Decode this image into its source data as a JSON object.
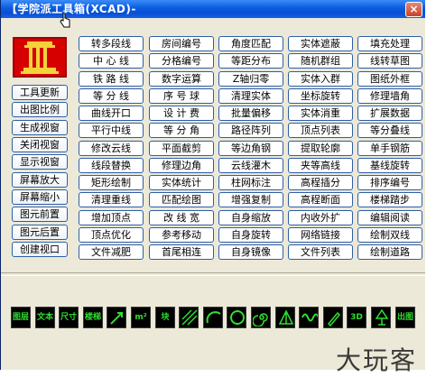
{
  "window": {
    "title": "【学院派工具箱(XCAD)-",
    "close": "×"
  },
  "left_buttons": [
    "工具更新",
    "出图比例",
    "生成视窗",
    "关闭视窗",
    "显示视窗",
    "屏幕放大",
    "屏幕缩小",
    "图元前置",
    "图元后置",
    "创建视口"
  ],
  "grid": [
    [
      "转多段线",
      "房间编号",
      "角度匹配",
      "实体遮蔽",
      "填充处理"
    ],
    [
      "中 心 线",
      "分格编号",
      "等距分布",
      "随机群组",
      "线转草图"
    ],
    [
      "铁 路 线",
      "数字运算",
      "Z轴归零",
      "实体入群",
      "图纸外框"
    ],
    [
      "等 分 线",
      "序 号 球",
      "清理实体",
      "坐标旋转",
      "修理墙角"
    ],
    [
      "曲线开口",
      "设 计 费",
      "批量偏移",
      "实体消重",
      "扩展数据"
    ],
    [
      "平行中线",
      "等 分 角",
      "路径阵列",
      "顶点列表",
      "等分叠线"
    ],
    [
      "修改云线",
      "平面截剪",
      "等边角钢",
      "提取轮廓",
      "单手钢筋"
    ],
    [
      "线段替换",
      "修理边角",
      "云线灌木",
      "夹等高线",
      "基线旋转"
    ],
    [
      "矩形绘制",
      "实体统计",
      "柱网标注",
      "高程插分",
      "排序编号"
    ],
    [
      "清理重线",
      "匹配绘图",
      "增强复制",
      "高程断面",
      "楼梯踏步"
    ],
    [
      "增加顶点",
      "改 线 宽",
      "自身缩放",
      "内收外扩",
      "编辑阅读"
    ],
    [
      "顶点优化",
      "参考移动",
      "自身旋转",
      "网络链接",
      "绘制双线"
    ],
    [
      "文件减肥",
      "首尾相连",
      "自身镜像",
      "文件列表",
      "绘制道路"
    ]
  ],
  "toolbar": [
    {
      "icon": "layer-icon",
      "text": "图层"
    },
    {
      "icon": "text-icon",
      "text": "文本"
    },
    {
      "icon": "dimension-icon",
      "text": "尺寸"
    },
    {
      "icon": "stairs-icon",
      "text": "楼梯"
    },
    {
      "icon": "arrow-icon",
      "text": ""
    },
    {
      "icon": "area-icon",
      "text": "m²"
    },
    {
      "icon": "block-icon",
      "text": "块"
    },
    {
      "icon": "hatch-icon",
      "text": ""
    },
    {
      "icon": "arc-icon",
      "text": ""
    },
    {
      "icon": "circle-icon",
      "text": ""
    },
    {
      "icon": "spiral-icon",
      "text": ""
    },
    {
      "icon": "pyramid-icon",
      "text": ""
    },
    {
      "icon": "wave-icon",
      "text": ""
    },
    {
      "icon": "brush-icon",
      "text": ""
    },
    {
      "icon": "3d-icon",
      "text": "3D"
    },
    {
      "icon": "tree-icon",
      "text": ""
    },
    {
      "icon": "output-icon",
      "text": "出图"
    }
  ],
  "watermark": "大玩客"
}
